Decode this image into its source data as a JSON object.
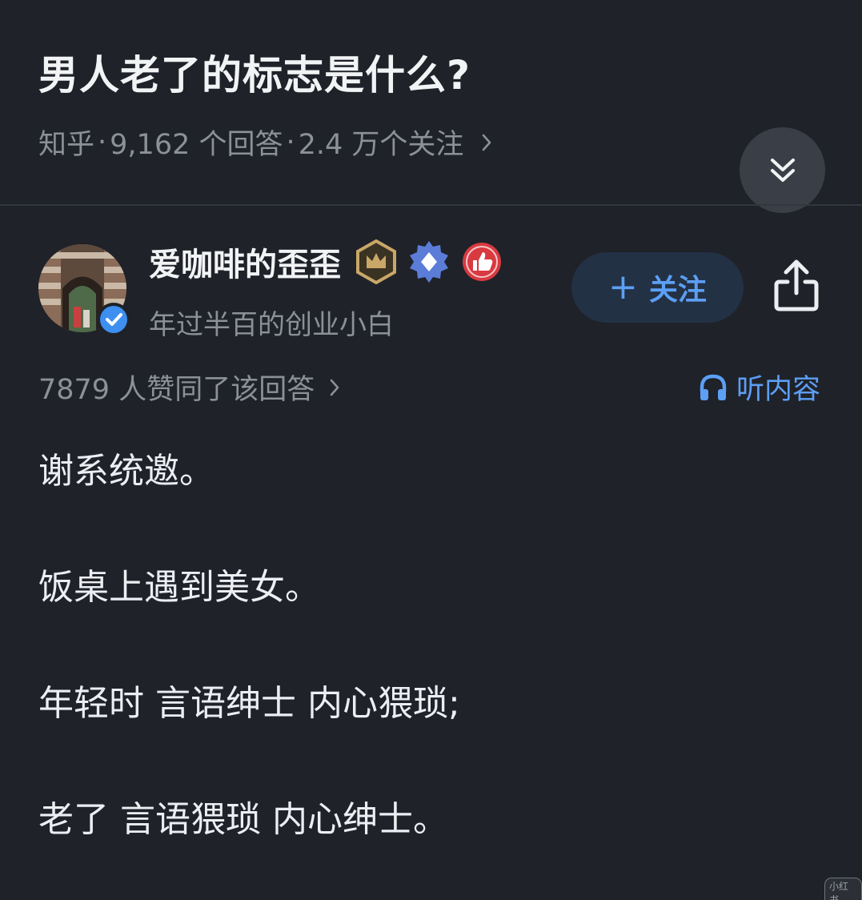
{
  "question": {
    "title": "男人老了的标志是什么?",
    "source": "知乎",
    "separator": "·",
    "answers_count": "9,162 个回答",
    "followers_count": "2.4 万个关注"
  },
  "author": {
    "name": "爱咖啡的歪歪",
    "bio": "年过半百的创业小白",
    "badges": [
      "crown-badge",
      "diamond-badge",
      "thumbs-up-badge"
    ],
    "verified": true
  },
  "actions": {
    "follow_plus": "+",
    "follow_label": "关注",
    "listen_label": "听内容"
  },
  "answer": {
    "approve_text": "7879 人赞同了该回答",
    "paragraphs": [
      "谢系统邀。",
      "饭桌上遇到美女。",
      "年轻时 言语绅士 内心猥琐;",
      "老了 言语猥琐 内心绅士。"
    ]
  },
  "watermark": "小红书",
  "colors": {
    "background": "#1f2229",
    "accent": "#5c9ff5",
    "follow_bg": "#233145",
    "muted_text": "#8b9099"
  }
}
